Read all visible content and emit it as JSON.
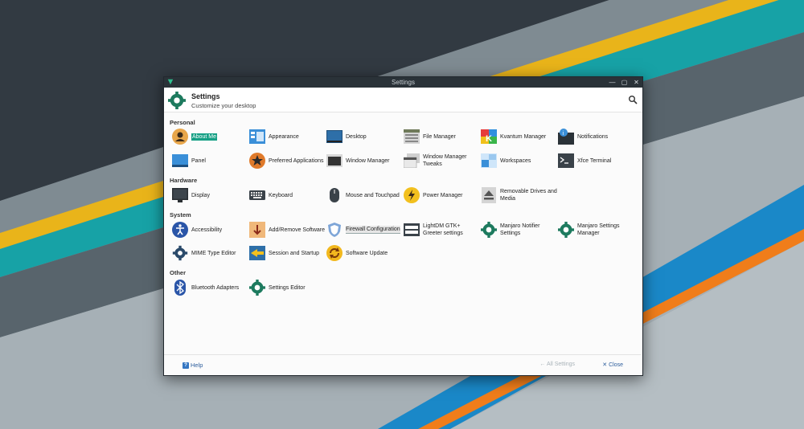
{
  "window": {
    "title": "Settings",
    "header_title": "Settings",
    "header_subtitle": "Customize your desktop"
  },
  "colors": {
    "accent": "#16a085",
    "manjaro_green": "#1d7a5e",
    "titlebar": "#2a3238",
    "stripe_yellow": "#e9b41a",
    "stripe_teal": "#17a2a6",
    "stripe_orange": "#f07d1a",
    "stripe_blue": "#1a88c8"
  },
  "icons": {
    "app": "manjaro-settings-icon",
    "search": "search-icon",
    "help": "help-icon"
  },
  "categories": {
    "personal": "Personal",
    "hardware": "Hardware",
    "system": "System",
    "other": "Other"
  },
  "personal": [
    {
      "label": "About Me",
      "icon": "user-icon"
    },
    {
      "label": "Appearance",
      "icon": "appearance-icon"
    },
    {
      "label": "Desktop",
      "icon": "desktop-icon"
    },
    {
      "label": "File Manager",
      "icon": "file-manager-icon"
    },
    {
      "label": "Kvantum Manager",
      "icon": "kvantum-icon"
    },
    {
      "label": "Notifications",
      "icon": "notifications-icon"
    },
    {
      "label": "Panel",
      "icon": "panel-icon"
    },
    {
      "label": "Preferred Applications",
      "icon": "preferred-apps-icon"
    },
    {
      "label": "Window Manager",
      "icon": "window-manager-icon"
    },
    {
      "label": "Window Manager Tweaks",
      "icon": "wm-tweaks-icon"
    },
    {
      "label": "Workspaces",
      "icon": "workspaces-icon"
    },
    {
      "label": "Xfce Terminal",
      "icon": "terminal-icon"
    }
  ],
  "hardware": [
    {
      "label": "Display",
      "icon": "display-icon"
    },
    {
      "label": "Keyboard",
      "icon": "keyboard-icon"
    },
    {
      "label": "Mouse and Touchpad",
      "icon": "mouse-icon"
    },
    {
      "label": "Power Manager",
      "icon": "power-icon"
    },
    {
      "label": "Removable Drives and Media",
      "icon": "eject-icon"
    }
  ],
  "system": [
    {
      "label": "Accessibility",
      "icon": "accessibility-icon"
    },
    {
      "label": "Add/Remove Software",
      "icon": "add-remove-software-icon"
    },
    {
      "label": "Firewall Configuration",
      "icon": "firewall-icon"
    },
    {
      "label": "LightDM GTK+ Greeter settings",
      "icon": "lightdm-icon"
    },
    {
      "label": "Manjaro Notifier Settings",
      "icon": "manjaro-notifier-icon"
    },
    {
      "label": "Manjaro Settings Manager",
      "icon": "manjaro-settings-icon"
    },
    {
      "label": "MIME Type Editor",
      "icon": "gear-icon"
    },
    {
      "label": "Session and Startup",
      "icon": "session-icon"
    },
    {
      "label": "Software Update",
      "icon": "update-icon"
    }
  ],
  "other": [
    {
      "label": "Bluetooth Adapters",
      "icon": "bluetooth-icon"
    },
    {
      "label": "Settings Editor",
      "icon": "settings-editor-icon"
    }
  ],
  "footer": {
    "help": "Help",
    "all_settings": "← All Settings",
    "close": "✕ Close"
  }
}
